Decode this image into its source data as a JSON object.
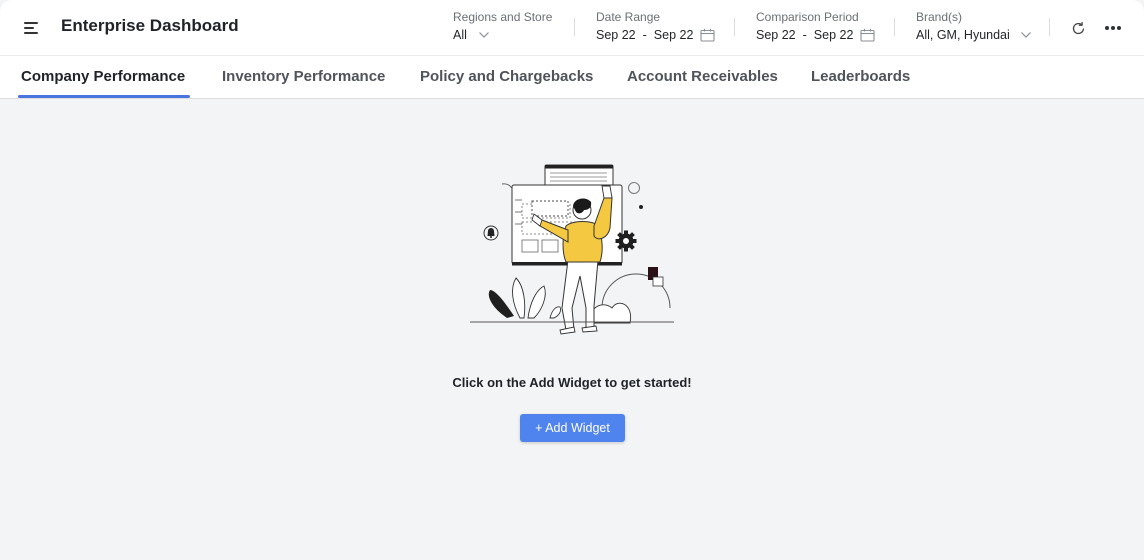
{
  "header": {
    "title": "Enterprise Dashboard",
    "filters": {
      "regions": {
        "label": "Regions and Store",
        "value": "All"
      },
      "date_range": {
        "label": "Date Range",
        "start": "Sep 22",
        "separator": "-",
        "end": "Sep 22"
      },
      "comparison": {
        "label": "Comparison Period",
        "start": "Sep 22",
        "separator": "-",
        "end": "Sep 22"
      },
      "brands": {
        "label": "Brand(s)",
        "value": "All, GM, Hyundai"
      }
    },
    "actions": {
      "refresh_icon": "refresh-icon",
      "more_icon": "more-horizontal-icon"
    }
  },
  "tabs": [
    {
      "label": "Company Performance",
      "active": true
    },
    {
      "label": "Inventory Performance",
      "active": false
    },
    {
      "label": "Policy and Chargebacks",
      "active": false
    },
    {
      "label": "Account Receivables",
      "active": false
    },
    {
      "label": "Leaderboards",
      "active": false
    }
  ],
  "empty_state": {
    "message": "Click on the Add Widget to get started!",
    "button_label": "+ Add Widget",
    "illustration_icon": "person-building-dashboard-illustration"
  },
  "colors": {
    "accent": "#4a74e0",
    "button": "#4f83ee",
    "background": "#f3f4f6",
    "illustration_yellow": "#f5c842"
  }
}
